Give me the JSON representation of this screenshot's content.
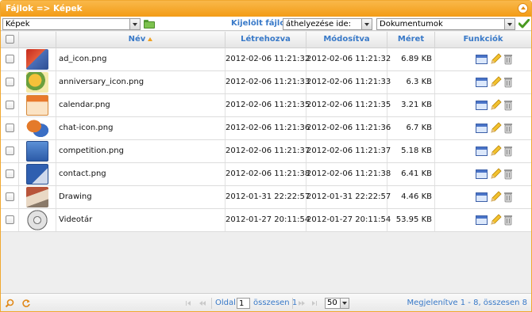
{
  "window": {
    "title": "Fájlok => Képek"
  },
  "toolbar": {
    "folder_select_value": "Képek",
    "selected_files_label": "Kijelölt fájlok",
    "action_select_value": "áthelyezése ide:",
    "target_select_value": "Dokumentumok"
  },
  "grid": {
    "columns": {
      "name": "Név",
      "created": "Létrehozva",
      "modified": "Módosítva",
      "size": "Méret",
      "functions": "Funkciók"
    },
    "sort": {
      "column": "name",
      "direction": "ascending"
    },
    "rows": [
      {
        "thumb_icon": "ad-icon-thumbnail",
        "name": "ad_icon.png",
        "created": "2012-02-06 11:21:32",
        "modified": "2012-02-06 11:21:32",
        "size": "6.89 KB"
      },
      {
        "thumb_icon": "anniversary-icon-thumbnail",
        "name": "anniversary_icon.png",
        "created": "2012-02-06 11:21:33",
        "modified": "2012-02-06 11:21:33",
        "size": "6.3 KB"
      },
      {
        "thumb_icon": "calendar-thumbnail",
        "name": "calendar.png",
        "created": "2012-02-06 11:21:35",
        "modified": "2012-02-06 11:21:35",
        "size": "3.21 KB"
      },
      {
        "thumb_icon": "chat-icon-thumbnail",
        "name": "chat-icon.png",
        "created": "2012-02-06 11:21:36",
        "modified": "2012-02-06 11:21:36",
        "size": "6.7 KB"
      },
      {
        "thumb_icon": "competition-thumbnail",
        "name": "competition.png",
        "created": "2012-02-06 11:21:37",
        "modified": "2012-02-06 11:21:37",
        "size": "5.18 KB"
      },
      {
        "thumb_icon": "contact-thumbnail",
        "name": "contact.png",
        "created": "2012-02-06 11:21:38",
        "modified": "2012-02-06 11:21:38",
        "size": "6.41 KB"
      },
      {
        "thumb_icon": "drawing-thumbnail",
        "name": "Drawing",
        "created": "2012-01-31 22:22:57",
        "modified": "2012-01-31 22:22:57",
        "size": "4.46 KB"
      },
      {
        "thumb_icon": "video-reel-thumbnail",
        "name": "Videotár",
        "created": "2012-01-27 20:11:54",
        "modified": "2012-01-27 20:11:54",
        "size": "53.95 KB"
      }
    ]
  },
  "pager": {
    "page_label": "Oldal",
    "page_value": "1",
    "total_label": "összesen 1",
    "page_size": "50",
    "summary": "Megjelenítve 1 - 8, összesen 8"
  },
  "colors": {
    "title_bar": "#f39c16",
    "link_blue": "#3879c8",
    "folder_green": "#7cc24e"
  }
}
